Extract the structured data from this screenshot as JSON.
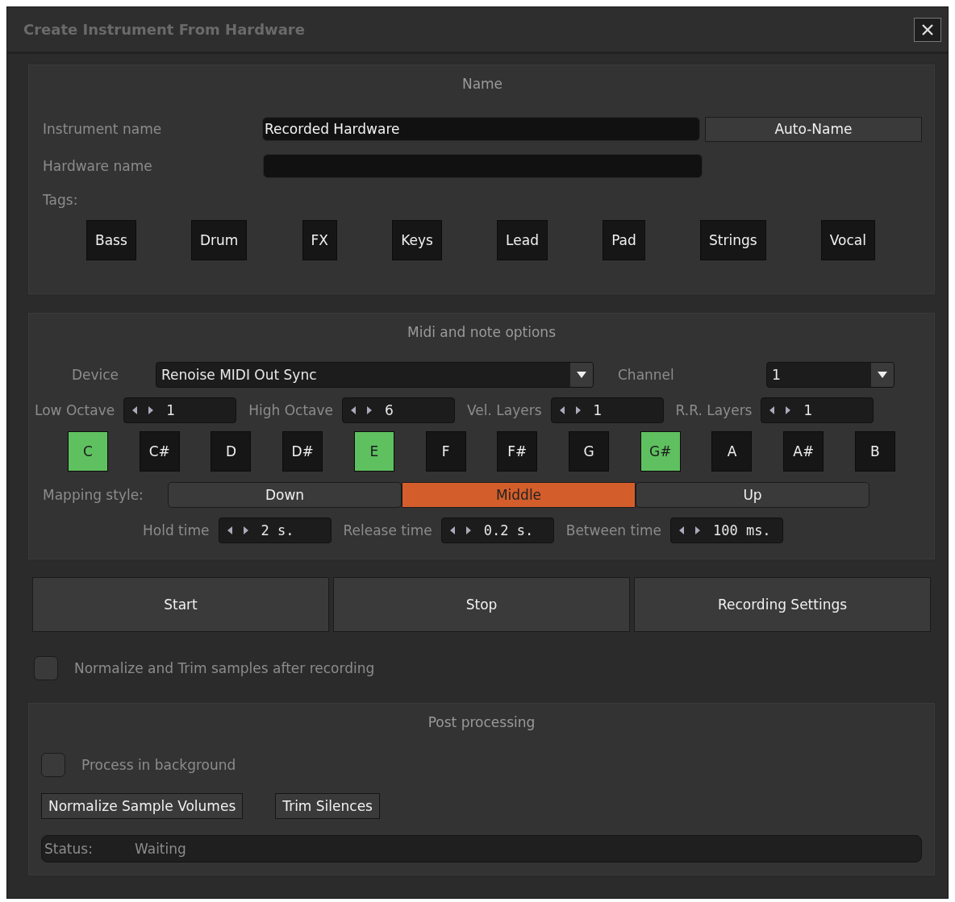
{
  "window": {
    "title": "Create Instrument From Hardware"
  },
  "name_section": {
    "heading": "Name",
    "instrument_name": {
      "label": "Instrument name",
      "value": "Recorded Hardware"
    },
    "auto_name_button": "Auto-Name",
    "hardware_name": {
      "label": "Hardware name"
    },
    "tags_label": "Tags:",
    "tags": [
      {
        "label": "Bass",
        "selected": false
      },
      {
        "label": "Drum",
        "selected": false
      },
      {
        "label": "FX",
        "selected": false
      },
      {
        "label": "Keys",
        "selected": false
      },
      {
        "label": "Lead",
        "selected": false
      },
      {
        "label": "Pad",
        "selected": false
      },
      {
        "label": "Strings",
        "selected": false
      },
      {
        "label": "Vocal",
        "selected": false
      }
    ]
  },
  "midi_section": {
    "heading": "Midi and note options",
    "device": {
      "label": "Device",
      "value": "Renoise MIDI Out Sync"
    },
    "channel": {
      "label": "Channel",
      "value": "1"
    },
    "spinners": [
      {
        "label": "Low Octave",
        "value": "1"
      },
      {
        "label": "High Octave",
        "value": "6"
      },
      {
        "label": "Vel. Layers",
        "value": "1"
      },
      {
        "label": "R.R. Layers",
        "value": "1"
      }
    ],
    "notes": [
      {
        "label": "C",
        "selected": true
      },
      {
        "label": "C#",
        "selected": false
      },
      {
        "label": "D",
        "selected": false
      },
      {
        "label": "D#",
        "selected": false
      },
      {
        "label": "E",
        "selected": true
      },
      {
        "label": "F",
        "selected": false
      },
      {
        "label": "F#",
        "selected": false
      },
      {
        "label": "G",
        "selected": false
      },
      {
        "label": "G#",
        "selected": true
      },
      {
        "label": "A",
        "selected": false
      },
      {
        "label": "A#",
        "selected": false
      },
      {
        "label": "B",
        "selected": false
      }
    ],
    "mapping_style": {
      "label": "Mapping style:",
      "options": [
        {
          "label": "Down",
          "selected": false
        },
        {
          "label": "Middle",
          "selected": true
        },
        {
          "label": "Up",
          "selected": false
        }
      ]
    },
    "times": [
      {
        "label": "Hold time",
        "value": "2 s."
      },
      {
        "label": "Release time",
        "value": "0.2 s."
      },
      {
        "label": "Between time",
        "value": "100 ms."
      }
    ]
  },
  "action_buttons": [
    "Start",
    "Stop",
    "Recording Settings"
  ],
  "normalize_option": {
    "label": "Normalize and Trim samples after recording",
    "checked": false
  },
  "post_section": {
    "heading": "Post processing",
    "background_option": {
      "label": "Process in background",
      "checked": false
    },
    "buttons": [
      "Normalize Sample Volumes",
      "Trim Silences"
    ],
    "status": {
      "label": "Status:",
      "value": "Waiting"
    }
  }
}
